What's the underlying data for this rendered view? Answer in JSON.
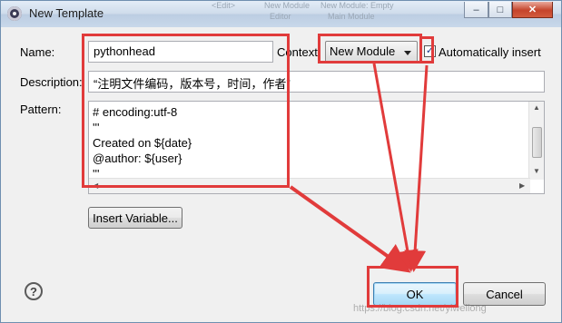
{
  "window": {
    "title": "New Template",
    "background_text": [
      "<Edit>",
      "New Module",
      "New Module: Empty",
      "Editor",
      "Main Module"
    ],
    "buttons": {
      "minimize": "–",
      "maximize": "□",
      "close": "✕"
    }
  },
  "form": {
    "name_label": "Name:",
    "name_value": "pythonhead",
    "context_label": "Context:",
    "context_value": "New Module",
    "auto_insert_label": "Automatically insert",
    "auto_insert_checked": true,
    "description_label": "Description:",
    "description_value": "“注明文件编码，版本号，时间，作者”",
    "pattern_label": "Pattern:",
    "pattern_lines": [
      "# encoding:utf-8",
      "'''",
      "Created on ${date}",
      "@author: ${user}",
      "'''"
    ]
  },
  "buttons": {
    "insert_variable": "Insert Variable...",
    "ok": "OK",
    "cancel": "Cancel",
    "help": "?"
  },
  "watermark": "https://blog.csdn.net/yiweilong",
  "colors": {
    "annotation": "#e13b3b"
  }
}
